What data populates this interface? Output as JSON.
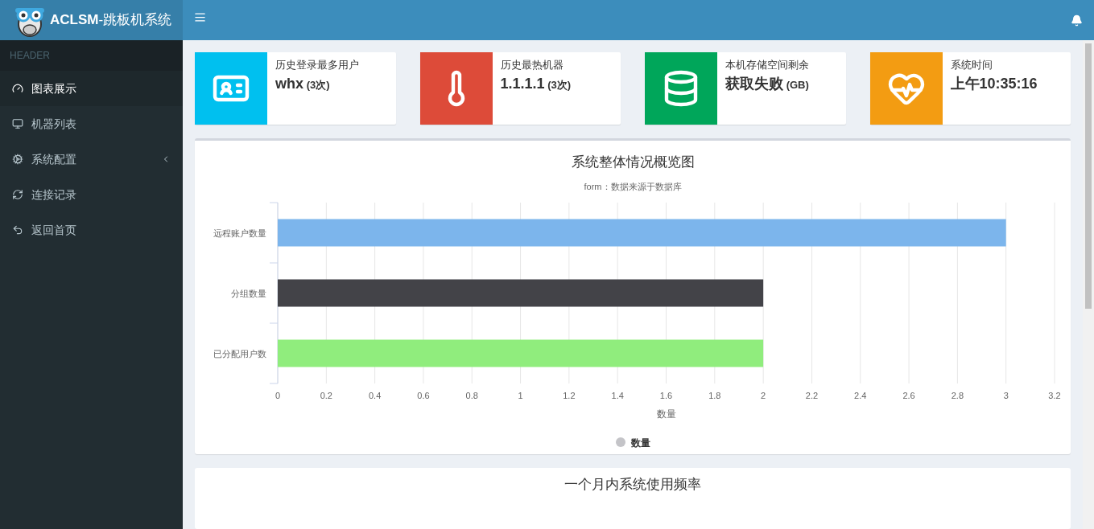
{
  "brand": {
    "name_bold": "ACLSM",
    "name_rest": "-跳板机系统"
  },
  "sidebar": {
    "header": "HEADER",
    "items": [
      {
        "label": "图表展示",
        "selected": true,
        "has_submenu": false
      },
      {
        "label": "机器列表",
        "selected": false,
        "has_submenu": false
      },
      {
        "label": "系统配置",
        "selected": false,
        "has_submenu": true
      },
      {
        "label": "连接记录",
        "selected": false,
        "has_submenu": false
      },
      {
        "label": "返回首页",
        "selected": false,
        "has_submenu": false
      }
    ]
  },
  "info_boxes": [
    {
      "color": "#00c0ef",
      "label": "历史登录最多用户",
      "value": "whx",
      "unit": "(3次)"
    },
    {
      "color": "#dd4b39",
      "label": "历史最热机器",
      "value": "1.1.1.1",
      "unit": "(3次)"
    },
    {
      "color": "#00a65a",
      "label": "本机存储空间剩余",
      "value": "获取失败",
      "unit": "(GB)"
    },
    {
      "color": "#f39c12",
      "label": "系统时间",
      "value": "上午10:35:16"
    }
  ],
  "overview_panel": {
    "title": "系统整体情况概览图",
    "subtitle": "form：数据来源于数据库",
    "chart_data": {
      "type": "bar",
      "orientation": "horizontal",
      "xlabel": "数量",
      "categories": [
        "远程账户数量",
        "分组数量",
        "已分配用户数"
      ],
      "series": [
        {
          "name": "数量",
          "values": [
            3,
            2,
            2
          ]
        }
      ],
      "grid": true,
      "xlim": [
        0,
        3.2
      ],
      "xticks": [
        0,
        0.2,
        0.4,
        0.6,
        0.8,
        1,
        1.2,
        1.4,
        1.6,
        1.8,
        2,
        2.2,
        2.4,
        2.6,
        2.8,
        3,
        3.2
      ]
    }
  },
  "usage_panel": {
    "title": "一个月内系统使用频率"
  }
}
